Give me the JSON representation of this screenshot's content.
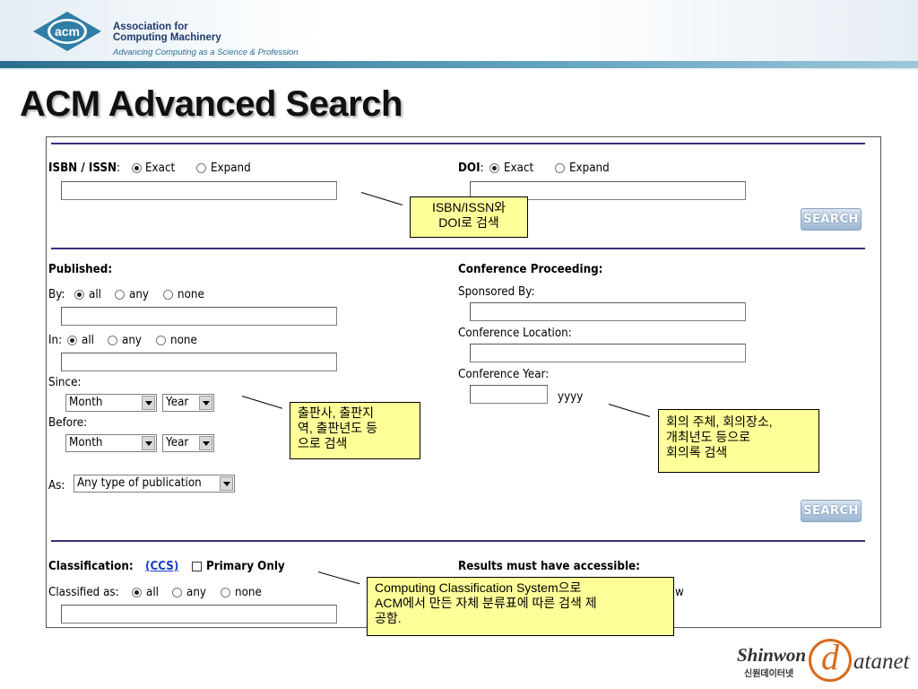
{
  "header": {
    "org_line1": "Association for",
    "org_line2": "Computing Machinery",
    "tagline": "Advancing Computing as a Science & Profession",
    "logo_text": "acm"
  },
  "slide_title": "ACM Advanced Search",
  "isbn": {
    "label": "ISBN / ISSN",
    "opt_exact": "Exact",
    "opt_expand": "Expand",
    "selected": "Exact"
  },
  "doi": {
    "label": "DOI",
    "opt_exact": "Exact",
    "opt_expand": "Expand",
    "selected": "Exact"
  },
  "search_button": "SEARCH",
  "published": {
    "heading": "Published:",
    "by_label": "By:",
    "in_label": "In:",
    "opt_all": "all",
    "opt_any": "any",
    "opt_none": "none",
    "since_label": "Since:",
    "before_label": "Before:",
    "month": "Month",
    "year": "Year",
    "as_label": "As:",
    "as_value": "Any type of publication"
  },
  "conference": {
    "heading": "Conference Proceeding:",
    "sponsored": "Sponsored By:",
    "location": "Conference Location:",
    "year": "Conference Year:",
    "year_hint": "yyyy"
  },
  "classification": {
    "heading": "Classification:",
    "ccs_link": "(CCS)",
    "primary_only": "Primary Only",
    "classified_as": "Classified as:",
    "opt_all": "all",
    "opt_any": "any",
    "opt_none": "none"
  },
  "results": {
    "heading": "Results must have accessible:",
    "partial": "w"
  },
  "callouts": {
    "isbn_doi": [
      "ISBN/ISSN와",
      "DOI로 검색"
    ],
    "published": [
      "출판사, 출판지",
      "역, 출판년도 등",
      "으로 검색"
    ],
    "conference": [
      "회의 주체, 회의장소,",
      "개최년도 등으로",
      "회의록 검색"
    ],
    "classification": [
      "Computing Classification System으로",
      "ACM에서 만든 자체 분류표에 따른 검색 제",
      "공함."
    ]
  },
  "brand": {
    "shinwon": "Shinwon",
    "shinwon_kr": "신원데이터넷",
    "datanet": "atanet",
    "at": "d"
  }
}
